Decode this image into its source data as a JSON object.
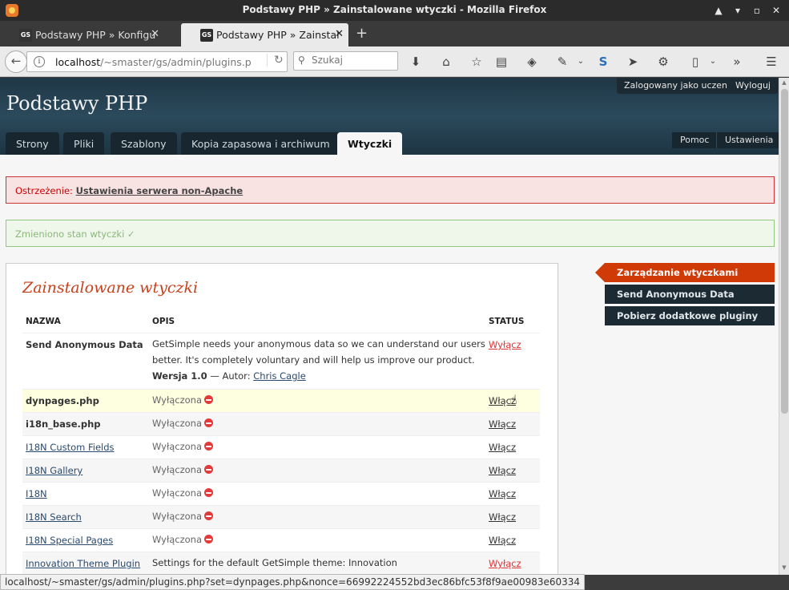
{
  "window": {
    "title": "Podstawy PHP » Zainstalowane wtyczki - Mozilla Firefox"
  },
  "tabs": [
    {
      "label": "Podstawy PHP » Konfigu",
      "favicon": "GS"
    },
    {
      "label": "Podstawy PHP » Zainstal",
      "favicon": "GS"
    }
  ],
  "navbar": {
    "url_host": "localhost",
    "url_path": "/~smaster/gs/admin/plugins.p",
    "search_placeholder": "Szukaj"
  },
  "site": {
    "title": "Podstawy PHP"
  },
  "user": {
    "logged_in": "Zalogowany jako uczen!",
    "logout": "Wyloguj"
  },
  "nav": {
    "tabs": [
      "Strony",
      "Pliki",
      "Szablony",
      "Kopia zapasowa i archiwum",
      "Wtyczki"
    ],
    "help": "Pomoc",
    "settings": "Ustawienia"
  },
  "alerts": {
    "warning_label": "Ostrzeżenie:",
    "warning_link": "Ustawienia serwera non-Apache",
    "success": "Zmieniono stan wtyczki ✓"
  },
  "main": {
    "title": "Zainstalowane wtyczki",
    "headers": {
      "name": "NAZWA",
      "desc": "OPIS",
      "status": "STATUS"
    },
    "first_plugin": {
      "name": "Send Anonymous Data",
      "desc": "GetSimple needs your anonymous data so we can understand our users better. It's completely voluntary and will help us improve our product.",
      "version": "Wersja 1.0",
      "author_sep": "— Autor:",
      "author": "Chris Cagle",
      "status": "Wyłącz"
    },
    "disabled_label": "Wyłączona",
    "enable_label": "Włącz",
    "rows": [
      {
        "name": "dynpages.php"
      },
      {
        "name": "i18n_base.php"
      },
      {
        "name": "I18N Custom Fields"
      },
      {
        "name": "I18N Gallery"
      },
      {
        "name": "I18N"
      },
      {
        "name": "I18N Search"
      },
      {
        "name": "I18N Special Pages"
      }
    ],
    "last_plugin": {
      "name": "Innovation Theme Plugin",
      "desc": "Settings for the default GetSimple theme: Innovation",
      "status": "Wyłącz"
    }
  },
  "sidebar": {
    "items": [
      "Zarządzanie wtyczkami",
      "Send Anonymous Data",
      "Pobierz dodatkowe pluginy"
    ]
  },
  "statusbar": {
    "url": "localhost/~smaster/gs/admin/plugins.php?set=dynpages.php&nonce=66992224552bd3ec86bfc53f8f9ae00983e60334"
  },
  "colors": {
    "accent": "#cf3a06",
    "header_dark": "#1c2a33",
    "error": "#cc0000",
    "success": "#8cb77c"
  }
}
